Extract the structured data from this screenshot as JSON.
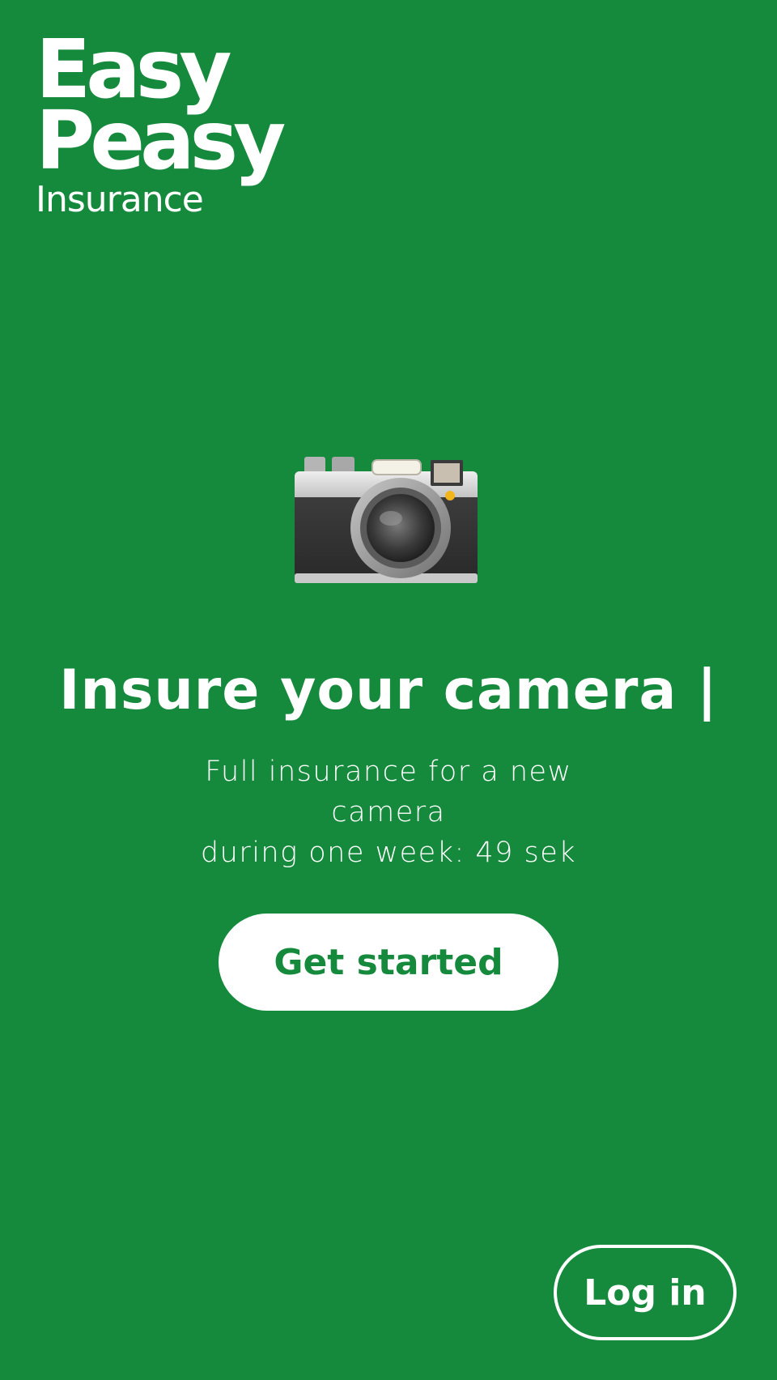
{
  "brand": {
    "line1": "Easy",
    "line2": "Peasy",
    "line3": "Insurance"
  },
  "hero": {
    "icon": "camera-icon",
    "headline": "Insure your camera |",
    "subtext_line1": "Full insurance for a new camera",
    "subtext_line2": "during one week: 49 sek"
  },
  "actions": {
    "get_started_label": "Get started",
    "login_label": "Log in"
  },
  "colors": {
    "background": "#168a3c",
    "primary_text": "#ffffff",
    "button_text": "#168a3c"
  }
}
